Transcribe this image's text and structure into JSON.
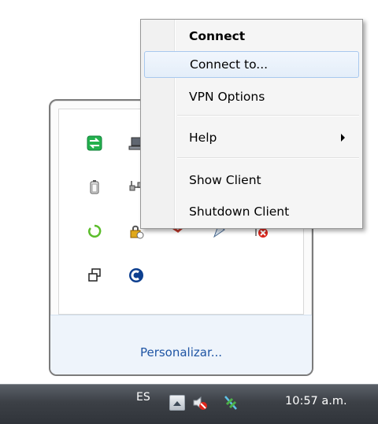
{
  "context_menu": {
    "items": [
      {
        "label": "Connect",
        "bold": true
      },
      {
        "label": "Connect to...",
        "highlighted": true
      },
      {
        "label": "VPN Options"
      },
      {
        "label": "Help",
        "submenu": true
      },
      {
        "label": "Show Client"
      },
      {
        "label": "Shutdown Client"
      }
    ]
  },
  "flyout": {
    "personalize_link": "Personalizar...",
    "icons": [
      "network-transfer-icon",
      "laptop-icon",
      "battery-icon",
      "network-cable-icon",
      "refresh-circle-icon",
      "vpn-lock-icon",
      "flag-icon",
      "pen-icon",
      "network-error-icon",
      "window-icon",
      "blue-app-icon"
    ]
  },
  "taskbar": {
    "language": "ES",
    "clock": "10:57 a.m.",
    "tray_icons": [
      "volume-muted-icon",
      "network-signal-icon"
    ]
  },
  "colors": {
    "link": "#1f55a4",
    "menu_highlight_border": "#a8c8ee",
    "taskbar": "#3c4046"
  }
}
